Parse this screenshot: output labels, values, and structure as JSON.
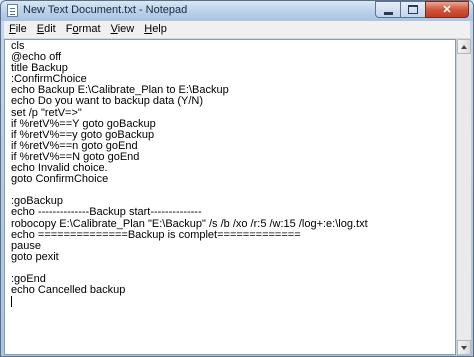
{
  "window": {
    "title": "New Text Document.txt - Notepad",
    "icon": "notepad-icon"
  },
  "controls": {
    "minimize_icon": "minimize-icon",
    "maximize_icon": "maximize-icon",
    "close_glyph": "✕"
  },
  "menu": [
    {
      "accel": "F",
      "rest": "ile"
    },
    {
      "accel": "E",
      "rest": "dit"
    },
    {
      "pre": "F",
      "accel": "o",
      "rest": "rmat"
    },
    {
      "accel": "V",
      "rest": "iew"
    },
    {
      "accel": "H",
      "rest": "elp"
    }
  ],
  "document": {
    "text": "cls\n@echo off\ntitle Backup\n:ConfirmChoice\necho Backup E:\\Calibrate_Plan to E:\\Backup\necho Do you want to backup data (Y/N)\nset /p \"retV=>\"\nif %retV%==Y goto goBackup\nif %retV%==y goto goBackup\nif %retV%==n goto goEnd\nif %retV%==N goto goEnd\necho Invalid choice.\ngoto ConfirmChoice\n\n:goBackup\necho --------------Backup start--------------\nrobocopy E:\\Calibrate_Plan \"E:\\Backup\" /s /b /xo /r:5 /w:15 /log+:e:\\log.txt\necho ==============Backup is complet=============\npause\ngoto pexit\n\n:goEnd\necho Cancelled backup\n"
  },
  "scrollbar": {
    "up_icon": "scroll-up-arrow-icon",
    "down_icon": "scroll-down-arrow-icon"
  }
}
